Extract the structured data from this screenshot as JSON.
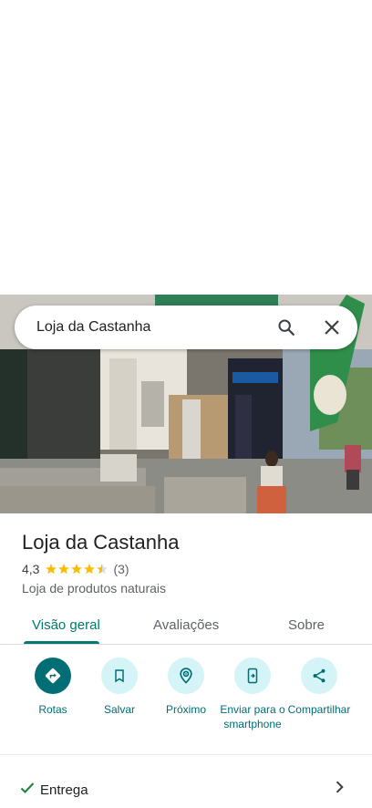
{
  "search": {
    "query": "Loja da Castanha"
  },
  "place": {
    "name": "Loja da Castanha",
    "rating": "4,3",
    "rating_value": 4.3,
    "review_count": "(3)",
    "category": "Loja de produtos naturais"
  },
  "tabs": [
    {
      "label": "Visão geral"
    },
    {
      "label": "Avaliações"
    },
    {
      "label": "Sobre"
    }
  ],
  "actions": [
    {
      "label": "Rotas",
      "icon": "directions-icon"
    },
    {
      "label": "Salvar",
      "icon": "bookmark-icon"
    },
    {
      "label": "Próximo",
      "icon": "nearby-icon"
    },
    {
      "label": "Enviar para o smartphone",
      "icon": "send-to-phone-icon"
    },
    {
      "label": "Compartilhar",
      "icon": "share-icon"
    }
  ],
  "delivery": {
    "label": "Entrega"
  },
  "colors": {
    "accent": "#016d75",
    "action_bg": "#d4f4f7",
    "star": "#fbbc04",
    "tab_active": "#01796f"
  }
}
